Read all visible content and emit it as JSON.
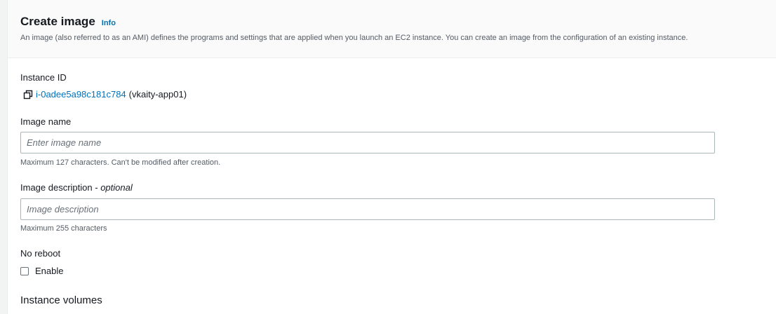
{
  "header": {
    "title": "Create image",
    "info_link": "Info",
    "description": "An image (also referred to as an AMI) defines the programs and settings that are applied when you launch an EC2 instance. You can create an image from the configuration of an existing instance."
  },
  "instance": {
    "label": "Instance ID",
    "id": "i-0adee5a98c181c784",
    "name": "(vkaity-app01)",
    "icon": "copy-icon"
  },
  "image_name": {
    "label": "Image name",
    "placeholder": "Enter image name",
    "value": "",
    "hint": "Maximum 127 characters. Can't be modified after creation."
  },
  "image_description": {
    "label": "Image description",
    "label_suffix": "optional",
    "placeholder": "Image description",
    "value": "",
    "hint": "Maximum 255 characters"
  },
  "no_reboot": {
    "label": "No reboot",
    "checkbox_label": "Enable",
    "checked": false
  },
  "instance_volumes": {
    "title": "Instance volumes"
  },
  "colors": {
    "link": "#0073bb",
    "text": "#16191f",
    "secondary_text": "#545b64",
    "border": "#aab7b8",
    "header_bg": "#fafafa"
  }
}
